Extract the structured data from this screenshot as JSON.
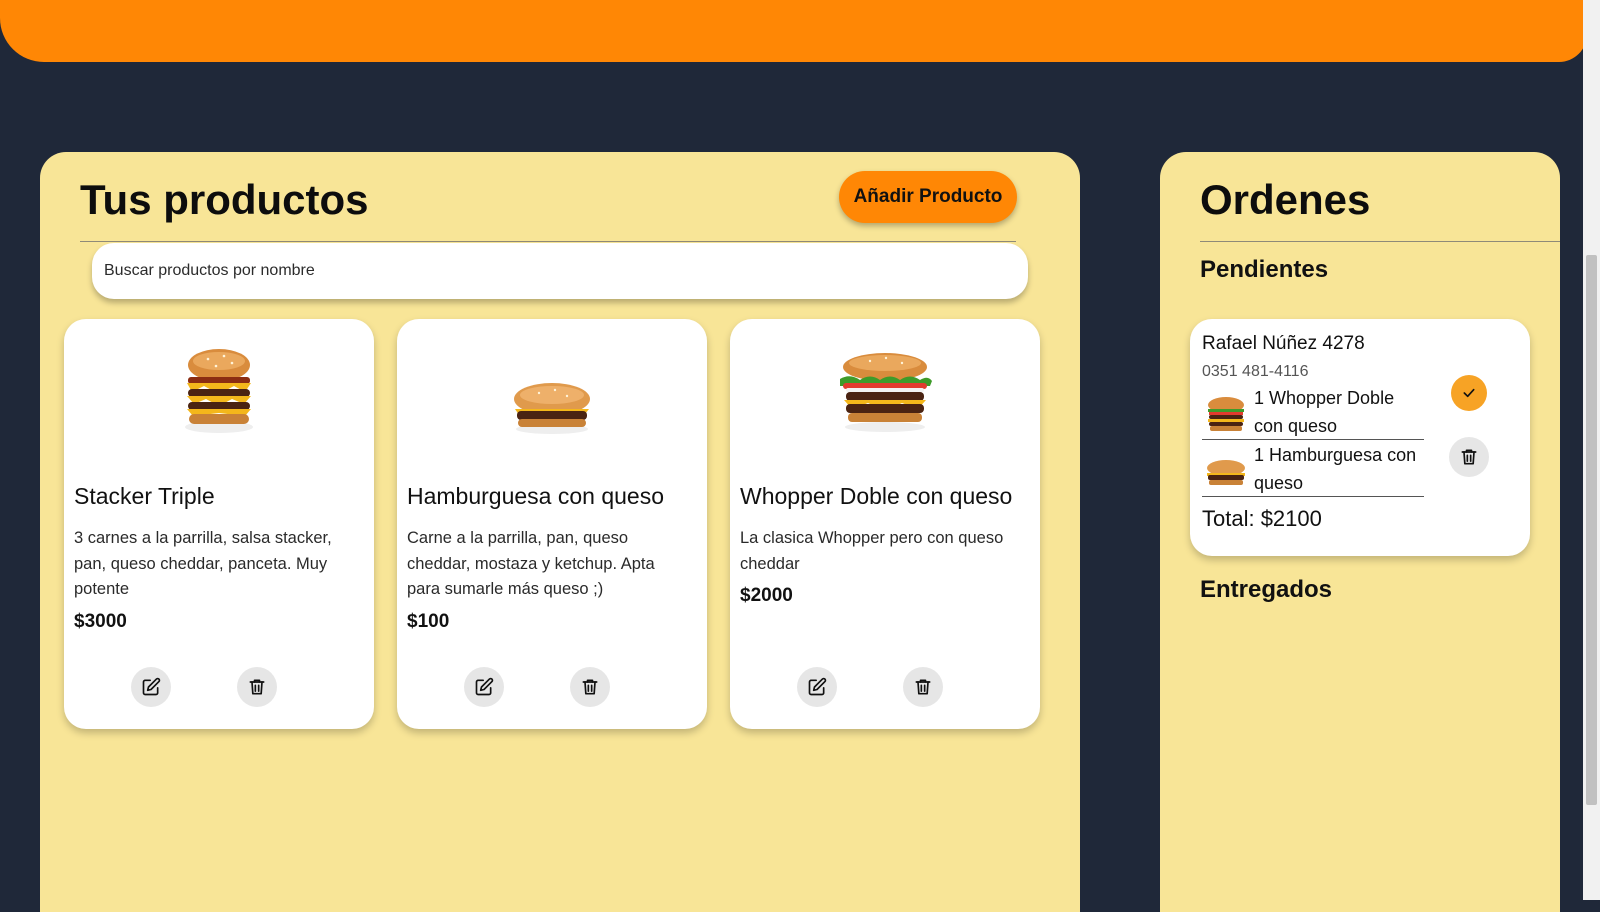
{
  "products": {
    "title": "Tus productos",
    "add_button": "Añadir Producto",
    "search_placeholder": "Buscar productos por nombre",
    "items": [
      {
        "name": "Stacker Triple",
        "description": "3 carnes a la parrilla, salsa stacker, pan, queso cheddar, panceta. Muy potente",
        "price": "$3000",
        "image": "burger-stacker-triple"
      },
      {
        "name": "Hamburguesa con queso",
        "description": "Carne a la parrilla, pan, queso cheddar, mostaza y ketchup. Apta para sumarle más queso ;)",
        "price": "$100",
        "image": "burger-cheeseburger"
      },
      {
        "name": "Whopper Doble con queso",
        "description": "La clasica Whopper pero con queso cheddar",
        "price": "$2000",
        "image": "burger-whopper-double"
      }
    ]
  },
  "orders": {
    "title": "Ordenes",
    "pending_title": "Pendientes",
    "delivered_title": "Entregados",
    "pending": [
      {
        "customer": "Rafael Núñez 4278",
        "phone": "0351 481-4116",
        "items": [
          {
            "label": "1 Whopper Doble con queso",
            "image": "burger-whopper-double"
          },
          {
            "label": "1 Hamburguesa con queso",
            "image": "burger-cheeseburger"
          }
        ],
        "total": "Total: $2100"
      }
    ]
  },
  "colors": {
    "background": "#1f2839",
    "accent_orange": "#ff8705",
    "panel_yellow": "#f8e597",
    "card_white": "#ffffff",
    "confirm_orange": "#f7a325"
  },
  "icons": {
    "edit": "edit-icon",
    "delete": "trash-icon",
    "confirm": "check-icon"
  }
}
